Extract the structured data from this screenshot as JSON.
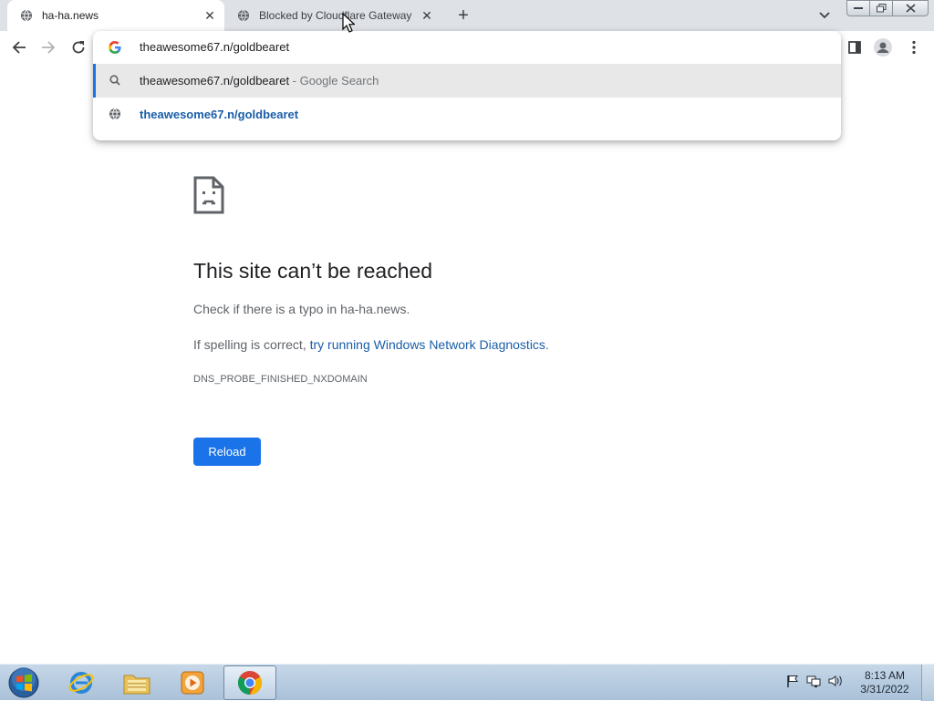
{
  "browser": {
    "tabs": [
      {
        "title": "ha-ha.news",
        "active": true,
        "icon": "globe-icon"
      },
      {
        "title": "Blocked by Cloudflare Gateway",
        "active": false,
        "icon": "globe-icon"
      }
    ],
    "new_tab_label": "+",
    "omnibox": {
      "input_value": "theawesome67.n/goldbearet",
      "suggestions": [
        {
          "text": "theawesome67.n/goldbearet",
          "suffix": " - Google Search",
          "icon": "search-icon"
        },
        {
          "text": "theawesome67.n/goldbearet",
          "suffix": "",
          "icon": "globe-icon"
        }
      ]
    }
  },
  "error_page": {
    "title": "This site can’t be reached",
    "typo_text": "Check if there is a typo in ha-ha.news.",
    "spelling_prefix": "If spelling is correct, ",
    "diagnostics_link": "try running Windows Network Diagnostics",
    "spelling_suffix": ".",
    "error_code": "DNS_PROBE_FINISHED_NXDOMAIN",
    "reload_label": "Reload"
  },
  "taskbar": {
    "apps": [
      "internet-explorer",
      "windows-explorer",
      "media-player",
      "google-chrome"
    ],
    "clock_time": "8:13 AM",
    "clock_date": "3/31/2022"
  },
  "colors": {
    "accent_blue": "#1a73e8",
    "link_blue": "#1a5ea8",
    "tabstrip_bg": "#dee1e6",
    "suggestion_highlight": "#e8e8e8"
  }
}
